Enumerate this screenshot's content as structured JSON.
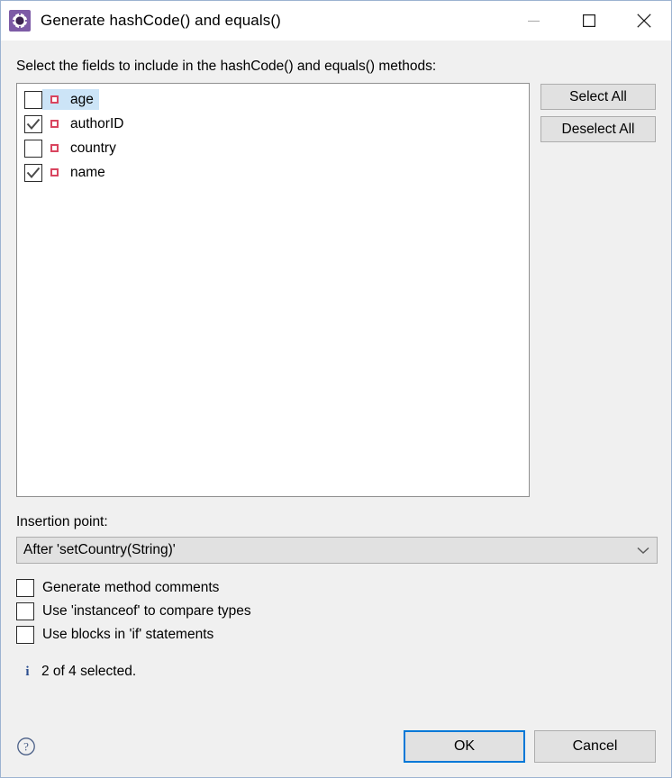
{
  "window": {
    "title": "Generate hashCode() and equals()",
    "icon": "eclipse-gear-icon",
    "controls": {
      "minimize": "minimize-icon",
      "maximize": "maximize-icon",
      "close": "close-icon"
    }
  },
  "instruction": "Select the fields to include in the hashCode() and equals() methods:",
  "fields": {
    "items": [
      {
        "label": "age",
        "checked": false,
        "selected": true
      },
      {
        "label": "authorID",
        "checked": true,
        "selected": false
      },
      {
        "label": "country",
        "checked": false,
        "selected": false
      },
      {
        "label": "name",
        "checked": true,
        "selected": false
      }
    ],
    "select_all_label": "Select All",
    "deselect_all_label": "Deselect All"
  },
  "insertion_point": {
    "label": "Insertion point:",
    "value": "After 'setCountry(String)'"
  },
  "options": [
    {
      "label": "Generate method comments",
      "checked": false
    },
    {
      "label": "Use 'instanceof' to compare types",
      "checked": false
    },
    {
      "label": "Use blocks in 'if' statements",
      "checked": false
    }
  ],
  "status": {
    "icon": "info-icon",
    "symbol": "i",
    "text": "2 of 4 selected."
  },
  "footer": {
    "help_icon": "help-icon",
    "ok_label": "OK",
    "cancel_label": "Cancel"
  },
  "colors": {
    "accent": "#0078d7",
    "selection": "#cce4f7",
    "field_icon": "#d9455f",
    "dialog_bg": "#f0f0f0",
    "border": "#9cb3d1",
    "info": "#2a4d8f"
  }
}
